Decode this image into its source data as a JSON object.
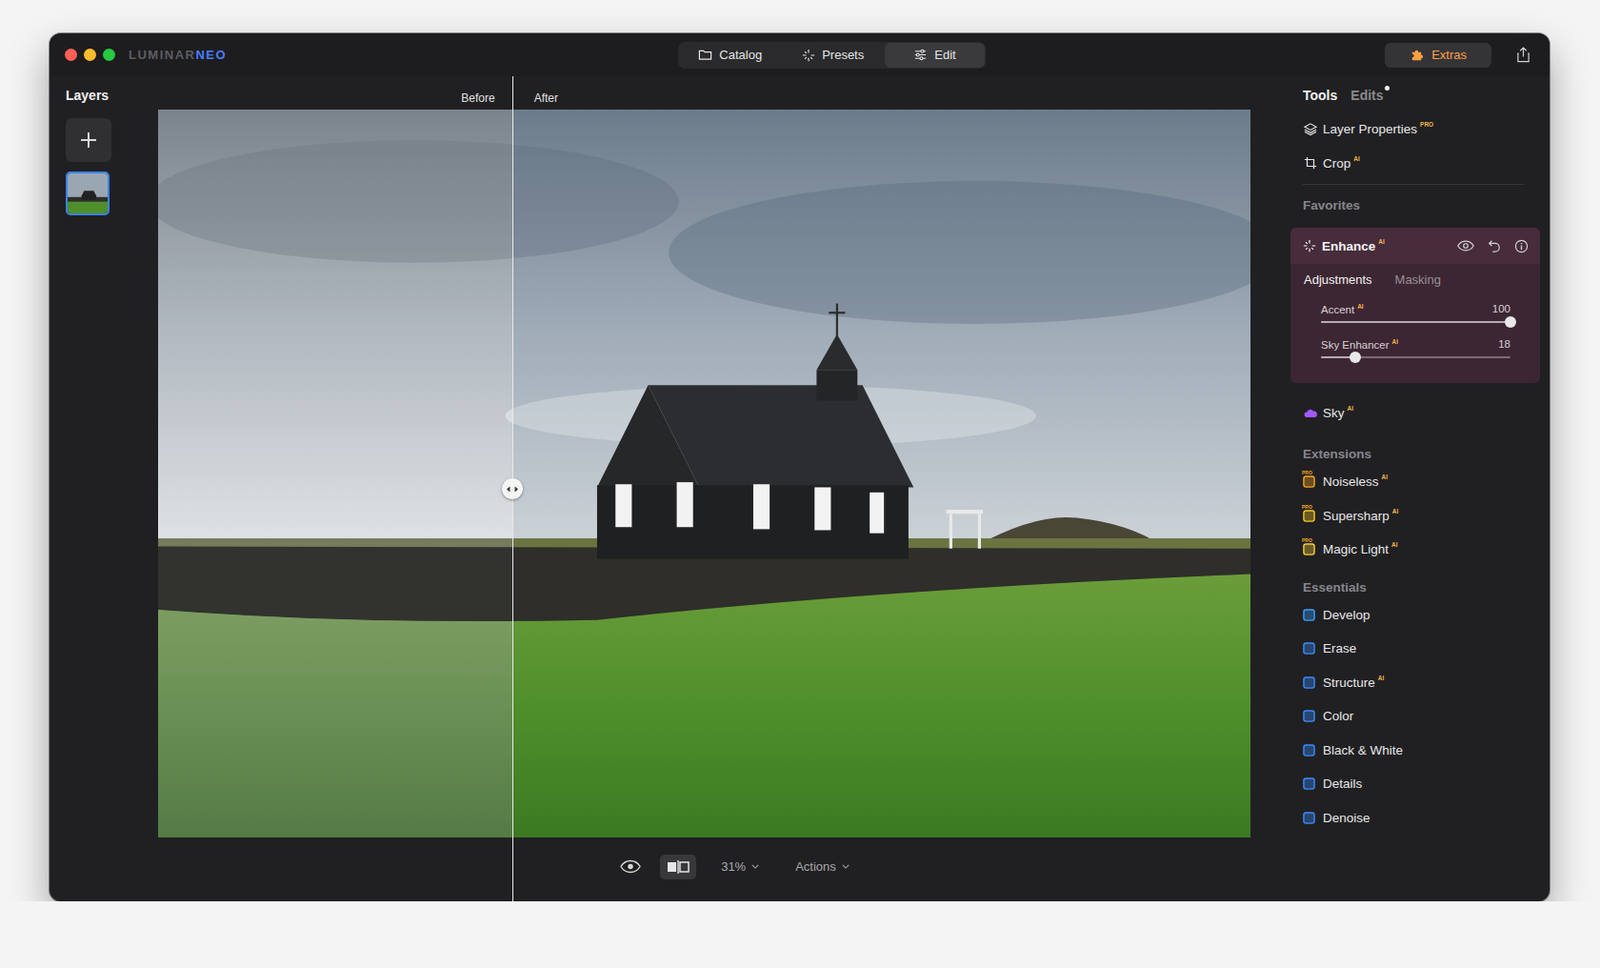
{
  "window": {
    "logo": {
      "primary": "LUMINAR",
      "accent": "NEO"
    }
  },
  "nav_tabs": [
    {
      "label": "Catalog",
      "selected": false
    },
    {
      "label": "Presets",
      "selected": false
    },
    {
      "label": "Edit",
      "selected": true
    }
  ],
  "extras": {
    "label": "Extras"
  },
  "layers": {
    "title": "Layers",
    "items": [
      {
        "selected": true
      }
    ]
  },
  "compare": {
    "before": "Before",
    "after": "After",
    "level": 0.324
  },
  "toolbar": {
    "preview_on": true,
    "compare_on": true,
    "zoom": "31%",
    "actions": "Actions"
  },
  "panel_tabs": [
    {
      "label": "Tools",
      "selected": true,
      "unsaved_dot": false
    },
    {
      "label": "Edits",
      "selected": false,
      "unsaved_dot": true
    }
  ],
  "top_tools": [
    {
      "label": "Layer Properties",
      "badge": "PRO"
    },
    {
      "label": "Crop",
      "badge": "AI"
    }
  ],
  "favorites": {
    "title": "Favorites",
    "tools": [
      {
        "label": "Enhance",
        "badge": "AI",
        "color": "#ffffff",
        "expanded": true,
        "subtabs": [
          {
            "label": "Adjustments",
            "selected": true
          },
          {
            "label": "Masking",
            "selected": false
          }
        ],
        "sliders": [
          {
            "label": "Accent",
            "badge": "AI",
            "reading": "100",
            "level": 1.0
          },
          {
            "label": "Sky Enhancer",
            "badge": "AI",
            "reading": "18",
            "level": 0.18
          }
        ]
      },
      {
        "label": "Sky",
        "badge": "AI",
        "color": "#a259ff",
        "expanded": false,
        "subtabs": [],
        "sliders": []
      }
    ]
  },
  "sections": [
    {
      "title": "Extensions",
      "tools": [
        {
          "label": "Noiseless",
          "badge": "AI",
          "icon_badge": "PRO",
          "color": "#f5a623"
        },
        {
          "label": "Supersharp",
          "badge": "AI",
          "icon_badge": "PRO",
          "color": "#f5c623"
        },
        {
          "label": "Magic Light",
          "badge": "AI",
          "icon_badge": "PRO",
          "color": "#f7d038"
        }
      ]
    },
    {
      "title": "Essentials",
      "tools": [
        {
          "label": "Develop",
          "badge": "",
          "icon_badge": "",
          "color": "#3aa0ff"
        },
        {
          "label": "Erase",
          "badge": "",
          "icon_badge": "",
          "color": "#3a8cff"
        },
        {
          "label": "Structure",
          "badge": "AI",
          "icon_badge": "",
          "color": "#3a8cff"
        },
        {
          "label": "Color",
          "badge": "",
          "icon_badge": "",
          "color": "#3a8cff"
        },
        {
          "label": "Black & White",
          "badge": "",
          "icon_badge": "",
          "color": "#3a8cff"
        },
        {
          "label": "Details",
          "badge": "",
          "icon_badge": "",
          "color": "#3a8cff"
        },
        {
          "label": "Denoise",
          "badge": "",
          "icon_badge": "",
          "color": "#3a8cff"
        }
      ]
    }
  ]
}
